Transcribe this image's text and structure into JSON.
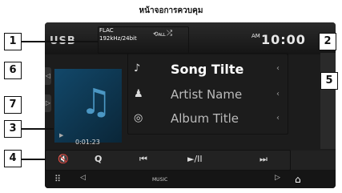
{
  "caption": "หน้าจอการควบคุม",
  "status": {
    "source": "USB",
    "format_line1": "FLAC",
    "format_line2": "192kHz/24bit",
    "repeat_label": "ALL",
    "clock": "10:00",
    "ampm": "AM"
  },
  "track": {
    "song_title": "Song Tilte",
    "artist_name": "Artist Name",
    "album_title": "Album Title",
    "play_time": "0:01:23"
  },
  "controls": {
    "mute": "🔇",
    "search": "Q",
    "prev": "⏮",
    "play_pause": "►/II",
    "next": "⏭"
  },
  "bottom": {
    "label": "MUSIC"
  },
  "callouts": [
    "1",
    "2",
    "3",
    "4",
    "5",
    "6",
    "7"
  ],
  "colors": {
    "screen_bg": "#1c1c1c",
    "art_blue": "#12486a",
    "note_blue": "#4b97c4"
  }
}
